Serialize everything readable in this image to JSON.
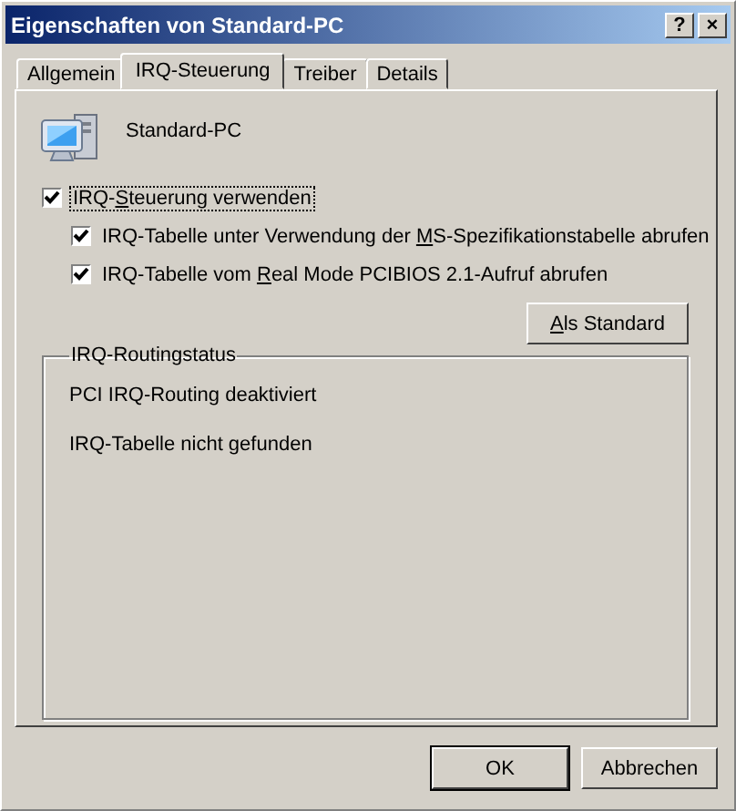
{
  "window": {
    "title": "Eigenschaften von Standard-PC",
    "title_buttons": [
      "?",
      "×"
    ]
  },
  "tabs": [
    {
      "label": "Allgemein",
      "selected": false
    },
    {
      "label": "IRQ-Steuerung",
      "selected": true
    },
    {
      "label": "Treiber",
      "selected": false
    },
    {
      "label": "Details",
      "selected": false
    }
  ],
  "device": {
    "name": "Standard-PC"
  },
  "options": [
    {
      "label": {
        "before": "IRQ-",
        "hotkey": "S",
        "after": "teuerung verwenden"
      },
      "checked": true,
      "focused": true,
      "children": [
        {
          "label": {
            "before": "IRQ-Tabelle unter Verwendung der ",
            "hotkey": "M",
            "after": "S-Spezifikationstabelle abrufen"
          },
          "checked": true,
          "focused": false
        },
        {
          "label": {
            "before": "IRQ-Tabelle vom ",
            "hotkey": "R",
            "after": "eal Mode PCIBIOS 2.1-Aufruf abrufen"
          },
          "checked": true,
          "focused": false
        }
      ]
    }
  ],
  "default_button": {
    "hotkey": "A",
    "after": "ls Standard"
  },
  "routing_status": {
    "title": "IRQ-Routingstatus",
    "lines": [
      "PCI IRQ-Routing deaktiviert",
      "IRQ-Tabelle nicht gefunden"
    ]
  },
  "buttons": [
    {
      "label": "OK",
      "default": true
    },
    {
      "label": "Abbrechen",
      "default": false
    }
  ]
}
